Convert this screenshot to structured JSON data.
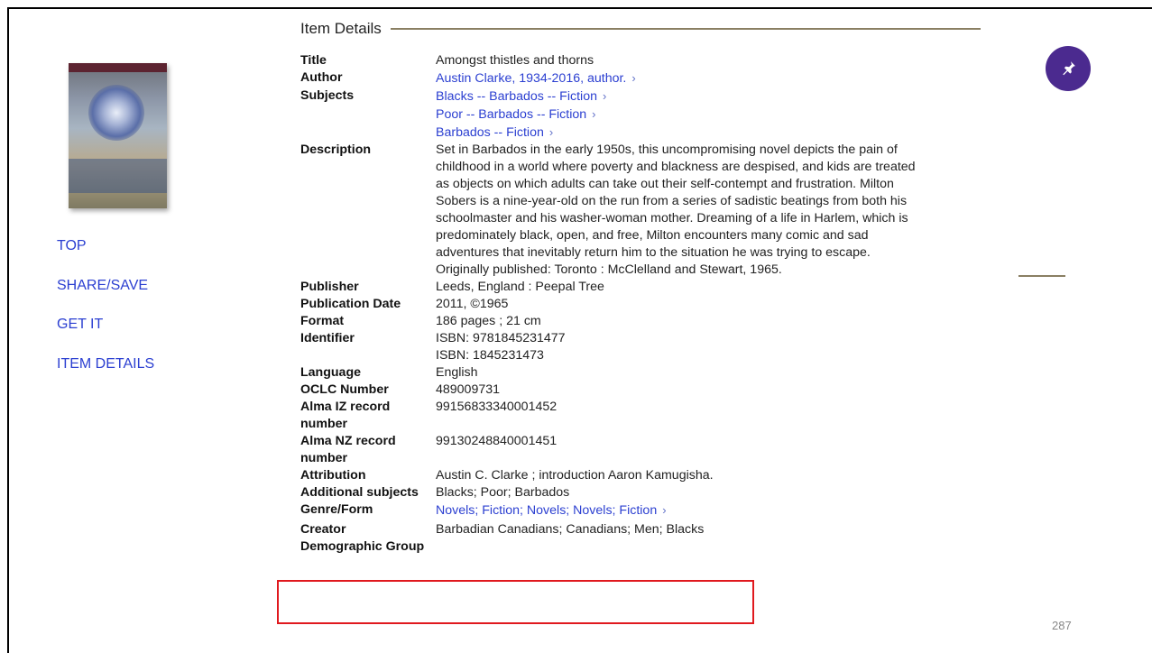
{
  "section": {
    "title": "Item Details"
  },
  "nav": {
    "items": [
      "TOP",
      "SHARE/SAVE",
      "GET IT",
      "ITEM DETAILS"
    ]
  },
  "colors": {
    "link": "#2b3fd1",
    "accent_rule": "#8a7f63",
    "pin_button": "#4b2a8f",
    "highlight_box": "#e0191e"
  },
  "details": {
    "title": {
      "label": "Title",
      "value": "Amongst thistles and thorns"
    },
    "author": {
      "label": "Author",
      "value": "Austin Clarke, 1934-2016, author."
    },
    "subjects": {
      "label": "Subjects",
      "items": [
        "Blacks -- Barbados -- Fiction",
        "Poor -- Barbados -- Fiction",
        "Barbados -- Fiction"
      ]
    },
    "description": {
      "label": "Description",
      "lines": [
        "Set in Barbados in the early 1950s, this uncompromising novel depicts the pain of",
        "childhood in a world where poverty and blackness are despised, and kids are treated",
        "as objects on which adults can take out their self-contempt and frustration. Milton",
        "Sobers is a nine-year-old on the run from a series of sadistic beatings from both his",
        "schoolmaster and his washer-woman mother. Dreaming of a life in Harlem, which is",
        "predominately black, open, and free, Milton encounters many comic and sad",
        "adventures that inevitably return him to the situation he was trying to escape.",
        "Originally published: Toronto : McClelland and Stewart, 1965."
      ]
    },
    "publisher": {
      "label": "Publisher",
      "value": "Leeds, England : Peepal Tree"
    },
    "publication_date": {
      "label": "Publication Date",
      "value": "2011, ©1965"
    },
    "format": {
      "label": "Format",
      "value": "186 pages ; 21 cm"
    },
    "identifier": {
      "label": "Identifier",
      "values": [
        "ISBN: 9781845231477",
        "ISBN: 1845231473"
      ]
    },
    "language": {
      "label": "Language",
      "value": "English"
    },
    "oclc": {
      "label": "OCLC Number",
      "value": "489009731"
    },
    "alma_iz": {
      "label_lines": [
        "Alma IZ record",
        "number"
      ],
      "value": "99156833340001452"
    },
    "alma_nz": {
      "label_lines": [
        "Alma NZ record",
        "number"
      ],
      "value": "99130248840001451"
    },
    "attribution": {
      "label": "Attribution",
      "value": "Austin C. Clarke ; introduction Aaron Kamugisha."
    },
    "additional_subjects": {
      "label": "Additional subjects",
      "value": "Blacks; Poor; Barbados"
    },
    "genre_form": {
      "label": "Genre/Form",
      "value": "Novels; Fiction; Novels; Novels; Fiction"
    },
    "creator_demographic": {
      "label_lines": [
        "Creator",
        "Demographic Group"
      ],
      "value": "Barbadian Canadians; Canadians; Men; Blacks"
    }
  },
  "page_number": "287",
  "icons": {
    "pin": "pin-icon",
    "chevron": "chevron-right-icon"
  }
}
